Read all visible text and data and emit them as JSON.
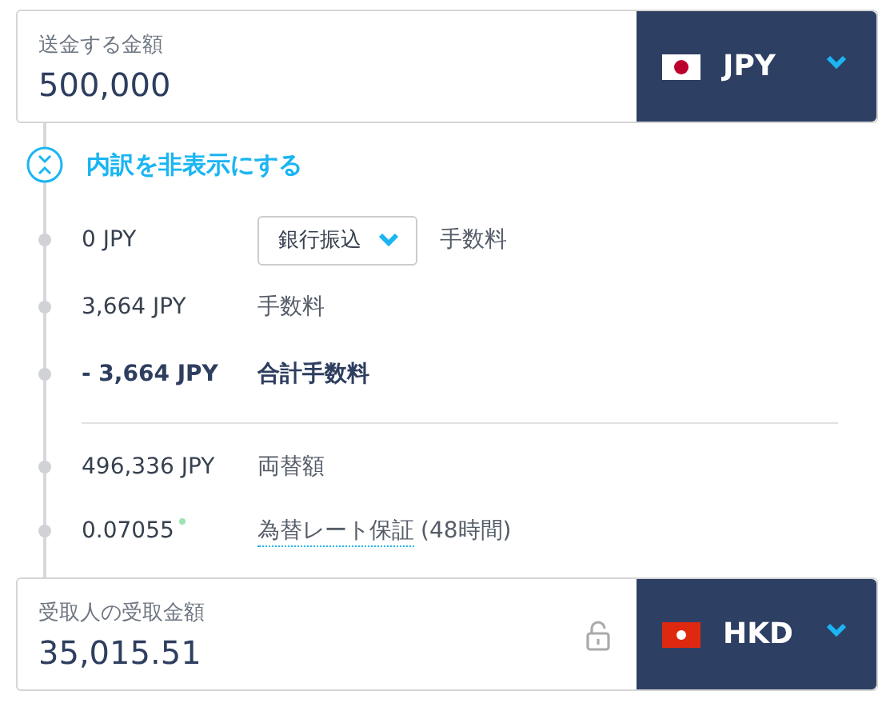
{
  "send": {
    "label": "送金する金額",
    "value": "500,000",
    "currency": "JPY",
    "flag": {
      "kind": "jp"
    }
  },
  "toggle": {
    "label": "内訳を非表示にする",
    "expanded": true
  },
  "fees": [
    {
      "kind": "select",
      "amount": "0 JPY",
      "method": "銀行振込",
      "label": "手数料"
    },
    {
      "kind": "plain",
      "amount": "3,664 JPY",
      "label": "手数料"
    },
    {
      "kind": "total",
      "amount": "- 3,664 JPY",
      "label": "合計手数料"
    }
  ],
  "conversion": [
    {
      "kind": "plain",
      "amount": "496,336 JPY",
      "label": "両替額"
    },
    {
      "kind": "rate",
      "amount": "0.07055",
      "link": "為替レート保証",
      "suffix": "(48時間)"
    }
  ],
  "receive": {
    "label": "受取人の受取金額",
    "value": "35,015.51",
    "currency": "HKD",
    "flag": {
      "kind": "hk"
    },
    "locked": false
  }
}
